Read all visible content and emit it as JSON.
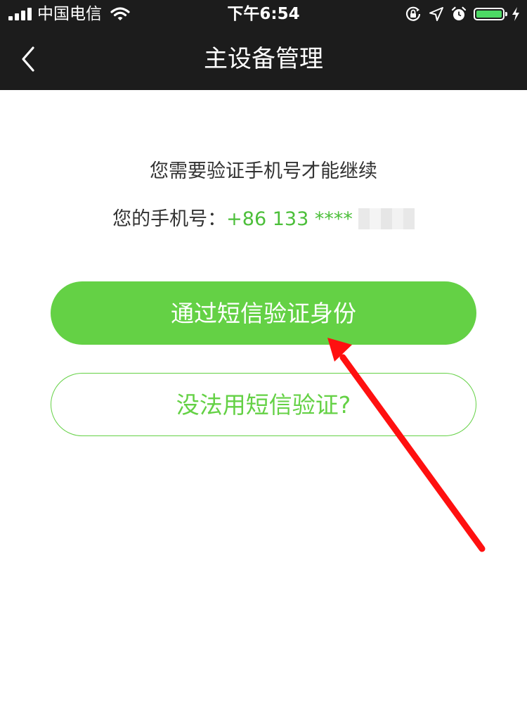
{
  "status_bar": {
    "carrier": "中国电信",
    "time": "下午6:54",
    "battery_level": 1.0,
    "battery_color": "#4cd964"
  },
  "nav": {
    "title": "主设备管理",
    "back_icon": "chevron-left-icon"
  },
  "verify": {
    "prompt": "您需要验证手机号才能继续",
    "phone_label": "您的手机号：",
    "phone_number": "+86 133 ****"
  },
  "buttons": {
    "sms_verify": "通过短信验证身份",
    "cannot_sms": "没法用短信验证?"
  },
  "colors": {
    "accent": "#64d145",
    "nav_bg": "#1c1c1c",
    "annotation_arrow": "#ff0000"
  }
}
